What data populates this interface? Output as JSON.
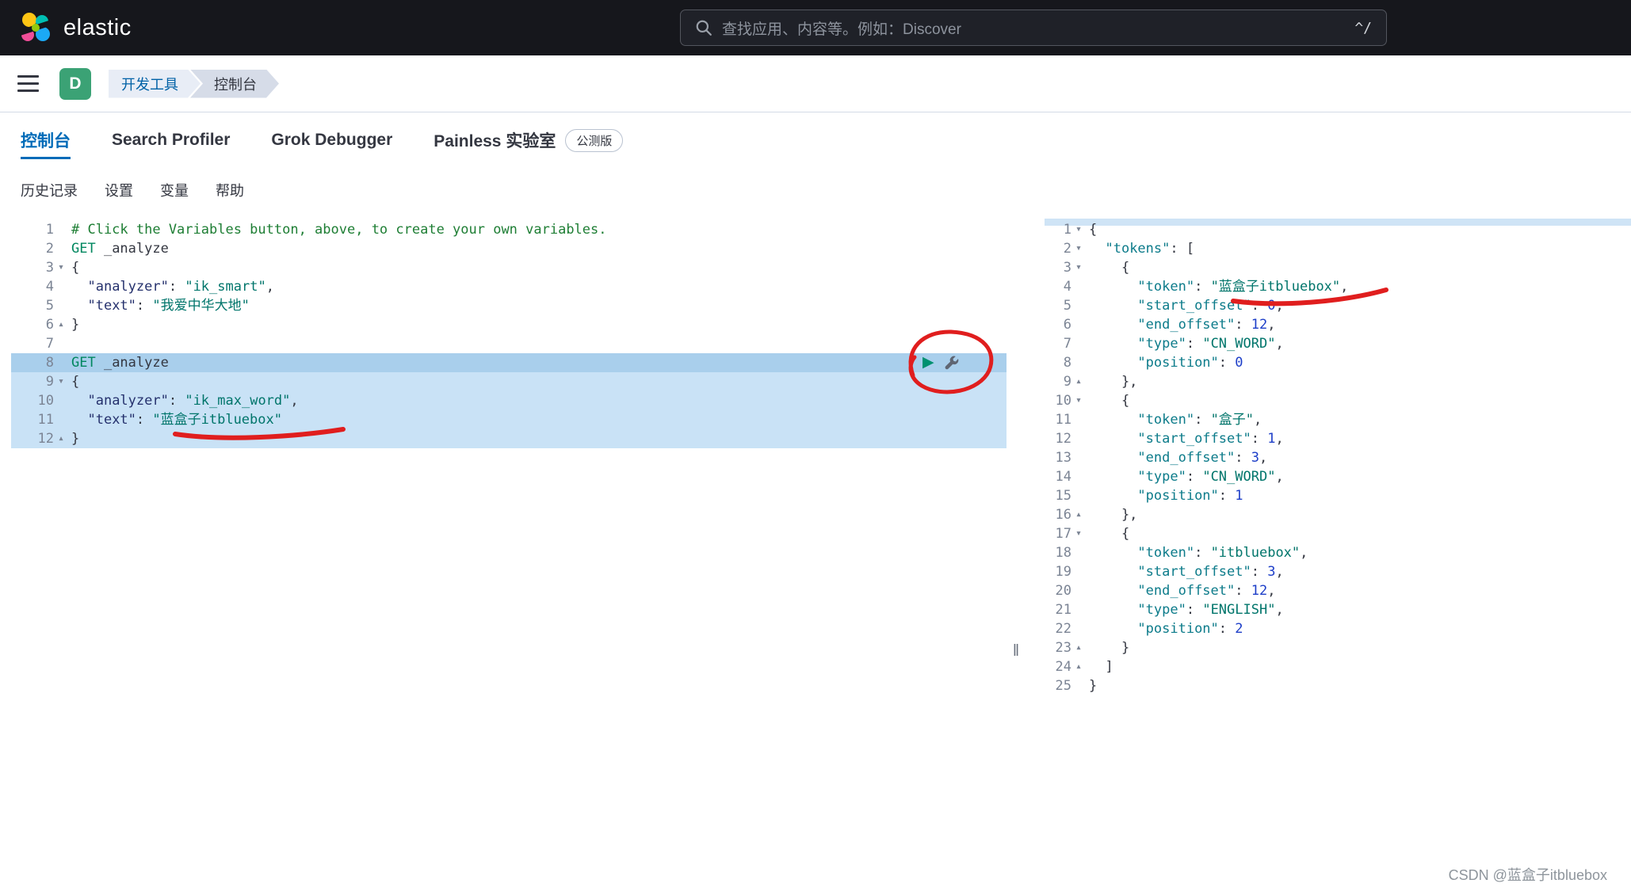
{
  "header": {
    "brand": "elastic",
    "search": {
      "placeholder": "查找应用、内容等。例如：Discover",
      "shortcut": "^/"
    }
  },
  "nav": {
    "space_badge": "D",
    "breadcrumbs": [
      {
        "label": "开发工具"
      },
      {
        "label": "控制台"
      }
    ]
  },
  "tabs": [
    {
      "label": "控制台"
    },
    {
      "label": "Search Profiler"
    },
    {
      "label": "Grok Debugger"
    },
    {
      "label": "Painless 实验室",
      "badge": "公测版"
    }
  ],
  "console_menu": [
    {
      "label": "历史记录"
    },
    {
      "label": "设置"
    },
    {
      "label": "变量"
    },
    {
      "label": "帮助"
    }
  ],
  "editor": {
    "lines": [
      {
        "n": 1,
        "s": [
          {
            "t": "# Click the Variables button, above, to create your own variables.",
            "c": "comment"
          }
        ]
      },
      {
        "n": 2,
        "s": [
          {
            "t": "GET",
            "c": "method"
          },
          {
            "t": " _analyze",
            "c": "url"
          }
        ]
      },
      {
        "n": 3,
        "f": "d",
        "s": [
          {
            "t": "{"
          }
        ]
      },
      {
        "n": 4,
        "s": [
          {
            "t": "  "
          },
          {
            "t": "\"analyzer\"",
            "c": "key"
          },
          {
            "t": ": "
          },
          {
            "t": "\"ik_smart\"",
            "c": "string"
          },
          {
            "t": ","
          }
        ]
      },
      {
        "n": 5,
        "s": [
          {
            "t": "  "
          },
          {
            "t": "\"text\"",
            "c": "key"
          },
          {
            "t": ": "
          },
          {
            "t": "\"我爱中华大地\"",
            "c": "string"
          }
        ]
      },
      {
        "n": 6,
        "f": "u",
        "s": [
          {
            "t": "}"
          }
        ]
      },
      {
        "n": 7,
        "s": []
      },
      {
        "n": 8,
        "a": true,
        "hl": true,
        "s": [
          {
            "t": "GET",
            "c": "method"
          },
          {
            "t": " _analyze",
            "c": "url"
          }
        ]
      },
      {
        "n": 9,
        "f": "d",
        "hl": true,
        "s": [
          {
            "t": "{"
          }
        ]
      },
      {
        "n": 10,
        "hl": true,
        "s": [
          {
            "t": "  "
          },
          {
            "t": "\"analyzer\"",
            "c": "key"
          },
          {
            "t": ": "
          },
          {
            "t": "\"ik_max_word\"",
            "c": "string"
          },
          {
            "t": ","
          }
        ]
      },
      {
        "n": 11,
        "hl": true,
        "s": [
          {
            "t": "  "
          },
          {
            "t": "\"text\"",
            "c": "key"
          },
          {
            "t": ": "
          },
          {
            "t": "\"蓝盒子itbluebox\"",
            "c": "string"
          }
        ]
      },
      {
        "n": 12,
        "f": "u",
        "hl": true,
        "s": [
          {
            "t": "}"
          }
        ]
      }
    ]
  },
  "response": {
    "lines": [
      {
        "n": 1,
        "f": "d",
        "s": [
          {
            "t": "{"
          }
        ]
      },
      {
        "n": 2,
        "f": "d",
        "s": [
          {
            "t": "  "
          },
          {
            "t": "\"tokens\"",
            "c": "rkey"
          },
          {
            "t": ": ["
          }
        ]
      },
      {
        "n": 3,
        "f": "d",
        "s": [
          {
            "t": "    {"
          }
        ]
      },
      {
        "n": 4,
        "s": [
          {
            "t": "      "
          },
          {
            "t": "\"token\"",
            "c": "rkey"
          },
          {
            "t": ": "
          },
          {
            "t": "\"蓝盒子itbluebox\"",
            "c": "string"
          },
          {
            "t": ","
          }
        ]
      },
      {
        "n": 5,
        "s": [
          {
            "t": "      "
          },
          {
            "t": "\"start_offset\"",
            "c": "rkey"
          },
          {
            "t": ": "
          },
          {
            "t": "0",
            "c": "number"
          },
          {
            "t": ","
          }
        ]
      },
      {
        "n": 6,
        "s": [
          {
            "t": "      "
          },
          {
            "t": "\"end_offset\"",
            "c": "rkey"
          },
          {
            "t": ": "
          },
          {
            "t": "12",
            "c": "number"
          },
          {
            "t": ","
          }
        ]
      },
      {
        "n": 7,
        "s": [
          {
            "t": "      "
          },
          {
            "t": "\"type\"",
            "c": "rkey"
          },
          {
            "t": ": "
          },
          {
            "t": "\"CN_WORD\"",
            "c": "string"
          },
          {
            "t": ","
          }
        ]
      },
      {
        "n": 8,
        "s": [
          {
            "t": "      "
          },
          {
            "t": "\"position\"",
            "c": "rkey"
          },
          {
            "t": ": "
          },
          {
            "t": "0",
            "c": "number"
          }
        ]
      },
      {
        "n": 9,
        "f": "u",
        "s": [
          {
            "t": "    },"
          }
        ]
      },
      {
        "n": 10,
        "f": "d",
        "s": [
          {
            "t": "    {"
          }
        ]
      },
      {
        "n": 11,
        "s": [
          {
            "t": "      "
          },
          {
            "t": "\"token\"",
            "c": "rkey"
          },
          {
            "t": ": "
          },
          {
            "t": "\"盒子\"",
            "c": "string"
          },
          {
            "t": ","
          }
        ]
      },
      {
        "n": 12,
        "s": [
          {
            "t": "      "
          },
          {
            "t": "\"start_offset\"",
            "c": "rkey"
          },
          {
            "t": ": "
          },
          {
            "t": "1",
            "c": "number"
          },
          {
            "t": ","
          }
        ]
      },
      {
        "n": 13,
        "s": [
          {
            "t": "      "
          },
          {
            "t": "\"end_offset\"",
            "c": "rkey"
          },
          {
            "t": ": "
          },
          {
            "t": "3",
            "c": "number"
          },
          {
            "t": ","
          }
        ]
      },
      {
        "n": 14,
        "s": [
          {
            "t": "      "
          },
          {
            "t": "\"type\"",
            "c": "rkey"
          },
          {
            "t": ": "
          },
          {
            "t": "\"CN_WORD\"",
            "c": "string"
          },
          {
            "t": ","
          }
        ]
      },
      {
        "n": 15,
        "s": [
          {
            "t": "      "
          },
          {
            "t": "\"position\"",
            "c": "rkey"
          },
          {
            "t": ": "
          },
          {
            "t": "1",
            "c": "number"
          }
        ]
      },
      {
        "n": 16,
        "f": "u",
        "s": [
          {
            "t": "    },"
          }
        ]
      },
      {
        "n": 17,
        "f": "d",
        "s": [
          {
            "t": "    {"
          }
        ]
      },
      {
        "n": 18,
        "s": [
          {
            "t": "      "
          },
          {
            "t": "\"token\"",
            "c": "rkey"
          },
          {
            "t": ": "
          },
          {
            "t": "\"itbluebox\"",
            "c": "string"
          },
          {
            "t": ","
          }
        ]
      },
      {
        "n": 19,
        "s": [
          {
            "t": "      "
          },
          {
            "t": "\"start_offset\"",
            "c": "rkey"
          },
          {
            "t": ": "
          },
          {
            "t": "3",
            "c": "number"
          },
          {
            "t": ","
          }
        ]
      },
      {
        "n": 20,
        "s": [
          {
            "t": "      "
          },
          {
            "t": "\"end_offset\"",
            "c": "rkey"
          },
          {
            "t": ": "
          },
          {
            "t": "12",
            "c": "number"
          },
          {
            "t": ","
          }
        ]
      },
      {
        "n": 21,
        "s": [
          {
            "t": "      "
          },
          {
            "t": "\"type\"",
            "c": "rkey"
          },
          {
            "t": ": "
          },
          {
            "t": "\"ENGLISH\"",
            "c": "string"
          },
          {
            "t": ","
          }
        ]
      },
      {
        "n": 22,
        "s": [
          {
            "t": "      "
          },
          {
            "t": "\"position\"",
            "c": "rkey"
          },
          {
            "t": ": "
          },
          {
            "t": "2",
            "c": "number"
          }
        ]
      },
      {
        "n": 23,
        "f": "u",
        "s": [
          {
            "t": "    }"
          }
        ]
      },
      {
        "n": 24,
        "f": "u",
        "s": [
          {
            "t": "  ]"
          }
        ]
      },
      {
        "n": 25,
        "s": [
          {
            "t": "}"
          }
        ]
      }
    ]
  },
  "watermark": "CSDN @蓝盒子itbluebox",
  "colors": {
    "accent": "#006bb8",
    "annotation_red": "#e01e1e",
    "selection": "#c9e2f6",
    "selection_active": "#a9cfec",
    "space_badge_green": "#3ba275"
  }
}
